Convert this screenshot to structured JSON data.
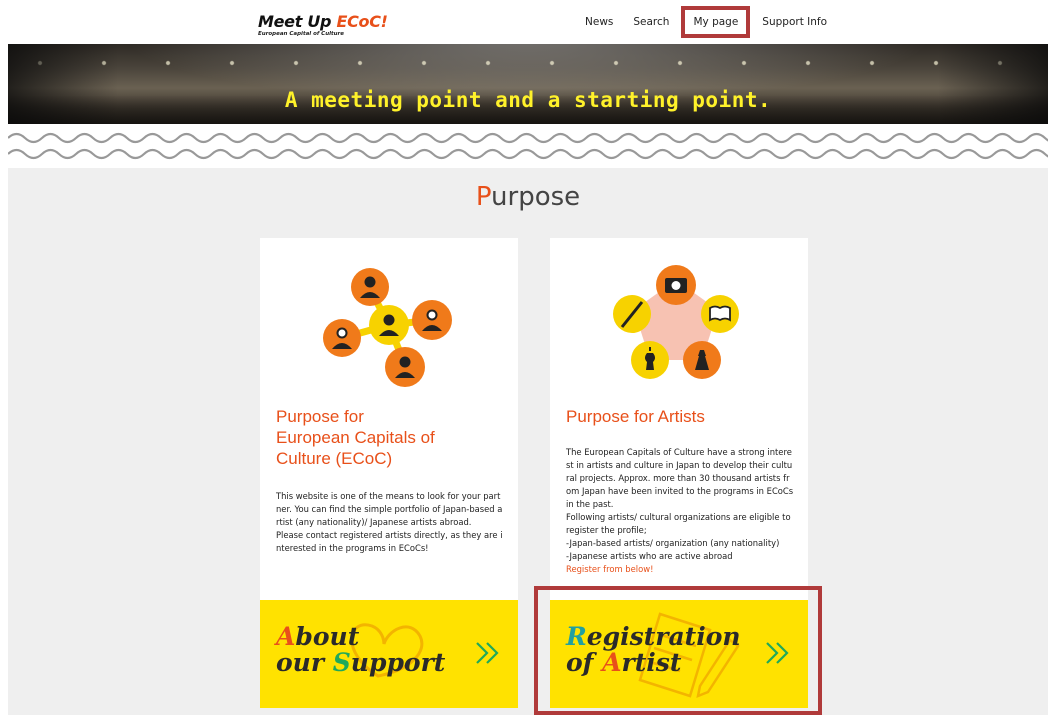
{
  "header": {
    "logo_main": "Meet Up ",
    "logo_accent": "ECoC!",
    "logo_sub": "European Capital of Culture",
    "nav": [
      "News",
      "Search",
      "My page",
      "Support Info"
    ],
    "active_nav": "My page"
  },
  "banner": {
    "tagline": "A meeting point and a starting point."
  },
  "purpose": {
    "title_first": "P",
    "title_rest": "urpose"
  },
  "card_ecoc": {
    "title_line1": "Purpose for",
    "title_line2": "European Capitals of",
    "title_line3": "Culture (ECoC)",
    "text_p1": "This website is one of the means to look for your partner. You can find the simple portfolio of Japan-based artist (any nationality)/ Japanese artists abroad.",
    "text_p2": "Please contact registered artists directly, as they are interested in the programs in ECoCs!",
    "cta_letter1": "A",
    "cta_word1": "bout",
    "cta_word2a": "our ",
    "cta_letter2": "S",
    "cta_word2b": "upport"
  },
  "card_artists": {
    "title": "Purpose for Artists",
    "text_p1": "The European Capitals of Culture have a strong interest in artists and culture in Japan to develop their cultural projects. Approx. more than 30 thousand artists from Japan have been invited to the programs in ECoCs in the past.",
    "text_p2": "Following artists/ cultural organizations are eligible to register the profile;",
    "text_p3": "-Japan-based artists/ organization (any nationality)",
    "text_p4": "-Japanese artists who are active abroad",
    "text_link": "Register from below!",
    "cta_letter1": "R",
    "cta_word1": "egistration",
    "cta_word2a": "of ",
    "cta_letter2": "A",
    "cta_word2b": "rtist"
  },
  "colors": {
    "accent_orange": "#e8501a",
    "cta_yellow": "#ffe200",
    "highlight_red": "#b03a3a",
    "banner_text_yellow": "#fff22a"
  }
}
